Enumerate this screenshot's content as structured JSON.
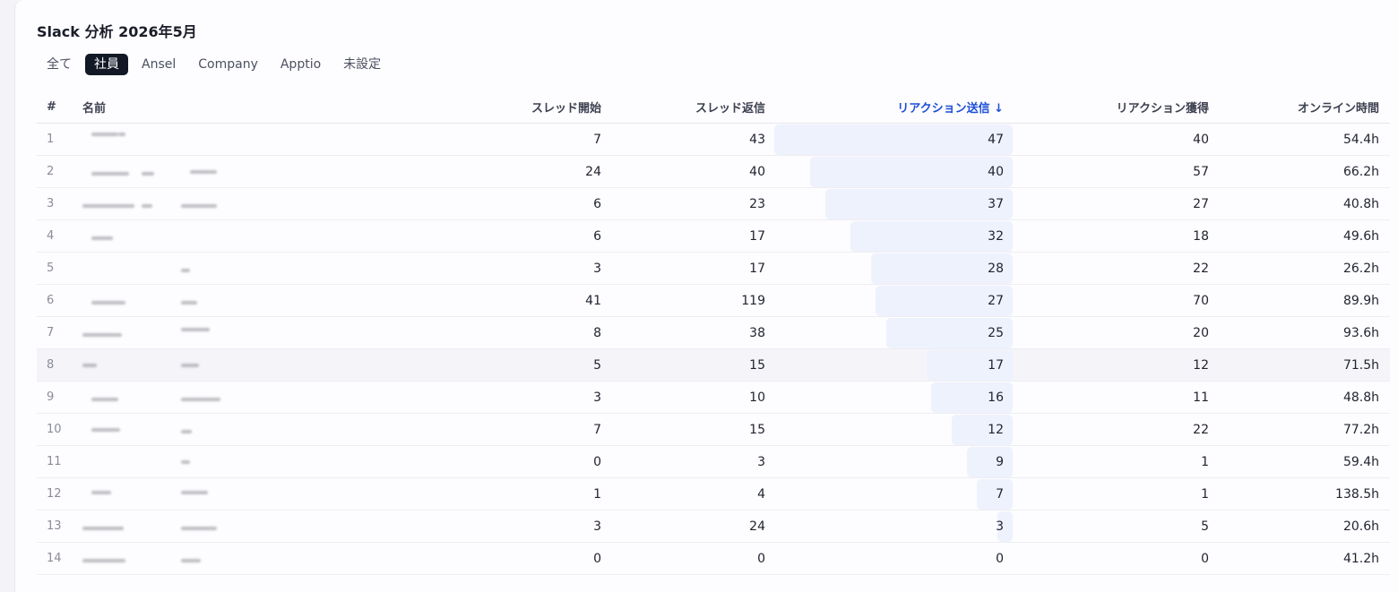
{
  "page_title": "Slack 分析 2026年5月",
  "tabs": [
    {
      "label": "全て",
      "active": false
    },
    {
      "label": "社員",
      "active": true
    },
    {
      "label": "Ansel",
      "active": false
    },
    {
      "label": "Company",
      "active": false
    },
    {
      "label": "Apptio",
      "active": false
    },
    {
      "label": "未設定",
      "active": false
    }
  ],
  "columns": {
    "index": "#",
    "name": "名前",
    "threads": "スレッド開始",
    "replies": "スレッド返信",
    "reactions_sent": "リアクション送信 ↓",
    "reactions_received": "リアクション獲得",
    "online": "オンライン時間"
  },
  "sort": {
    "column": "reactions_sent",
    "direction": "desc",
    "max_value": 47
  },
  "colors": {
    "accent": "#1d4ed8",
    "bar": "#eef2fd",
    "active_tab": "#121826"
  },
  "rows": [
    {
      "index": "1",
      "threads": "7",
      "replies": "43",
      "reactions_sent": "47",
      "reactions_received": "40",
      "online": "54.4h"
    },
    {
      "index": "2",
      "threads": "24",
      "replies": "40",
      "reactions_sent": "40",
      "reactions_received": "57",
      "online": "66.2h"
    },
    {
      "index": "3",
      "threads": "6",
      "replies": "23",
      "reactions_sent": "37",
      "reactions_received": "27",
      "online": "40.8h"
    },
    {
      "index": "4",
      "threads": "6",
      "replies": "17",
      "reactions_sent": "32",
      "reactions_received": "18",
      "online": "49.6h"
    },
    {
      "index": "5",
      "threads": "3",
      "replies": "17",
      "reactions_sent": "28",
      "reactions_received": "22",
      "online": "26.2h"
    },
    {
      "index": "6",
      "threads": "41",
      "replies": "119",
      "reactions_sent": "27",
      "reactions_received": "70",
      "online": "89.9h"
    },
    {
      "index": "7",
      "threads": "8",
      "replies": "38",
      "reactions_sent": "25",
      "reactions_received": "20",
      "online": "93.6h"
    },
    {
      "index": "8",
      "threads": "5",
      "replies": "15",
      "reactions_sent": "17",
      "reactions_received": "12",
      "online": "71.5h"
    },
    {
      "index": "9",
      "threads": "3",
      "replies": "10",
      "reactions_sent": "16",
      "reactions_received": "11",
      "online": "48.8h"
    },
    {
      "index": "10",
      "threads": "7",
      "replies": "15",
      "reactions_sent": "12",
      "reactions_received": "22",
      "online": "77.2h"
    },
    {
      "index": "11",
      "threads": "0",
      "replies": "3",
      "reactions_sent": "9",
      "reactions_received": "1",
      "online": "59.4h"
    },
    {
      "index": "12",
      "threads": "1",
      "replies": "4",
      "reactions_sent": "7",
      "reactions_received": "1",
      "online": "138.5h"
    },
    {
      "index": "13",
      "threads": "3",
      "replies": "24",
      "reactions_sent": "3",
      "reactions_received": "5",
      "online": "20.6h"
    },
    {
      "index": "14",
      "threads": "0",
      "replies": "0",
      "reactions_sent": "0",
      "reactions_received": "0",
      "online": "41.2h"
    }
  ]
}
